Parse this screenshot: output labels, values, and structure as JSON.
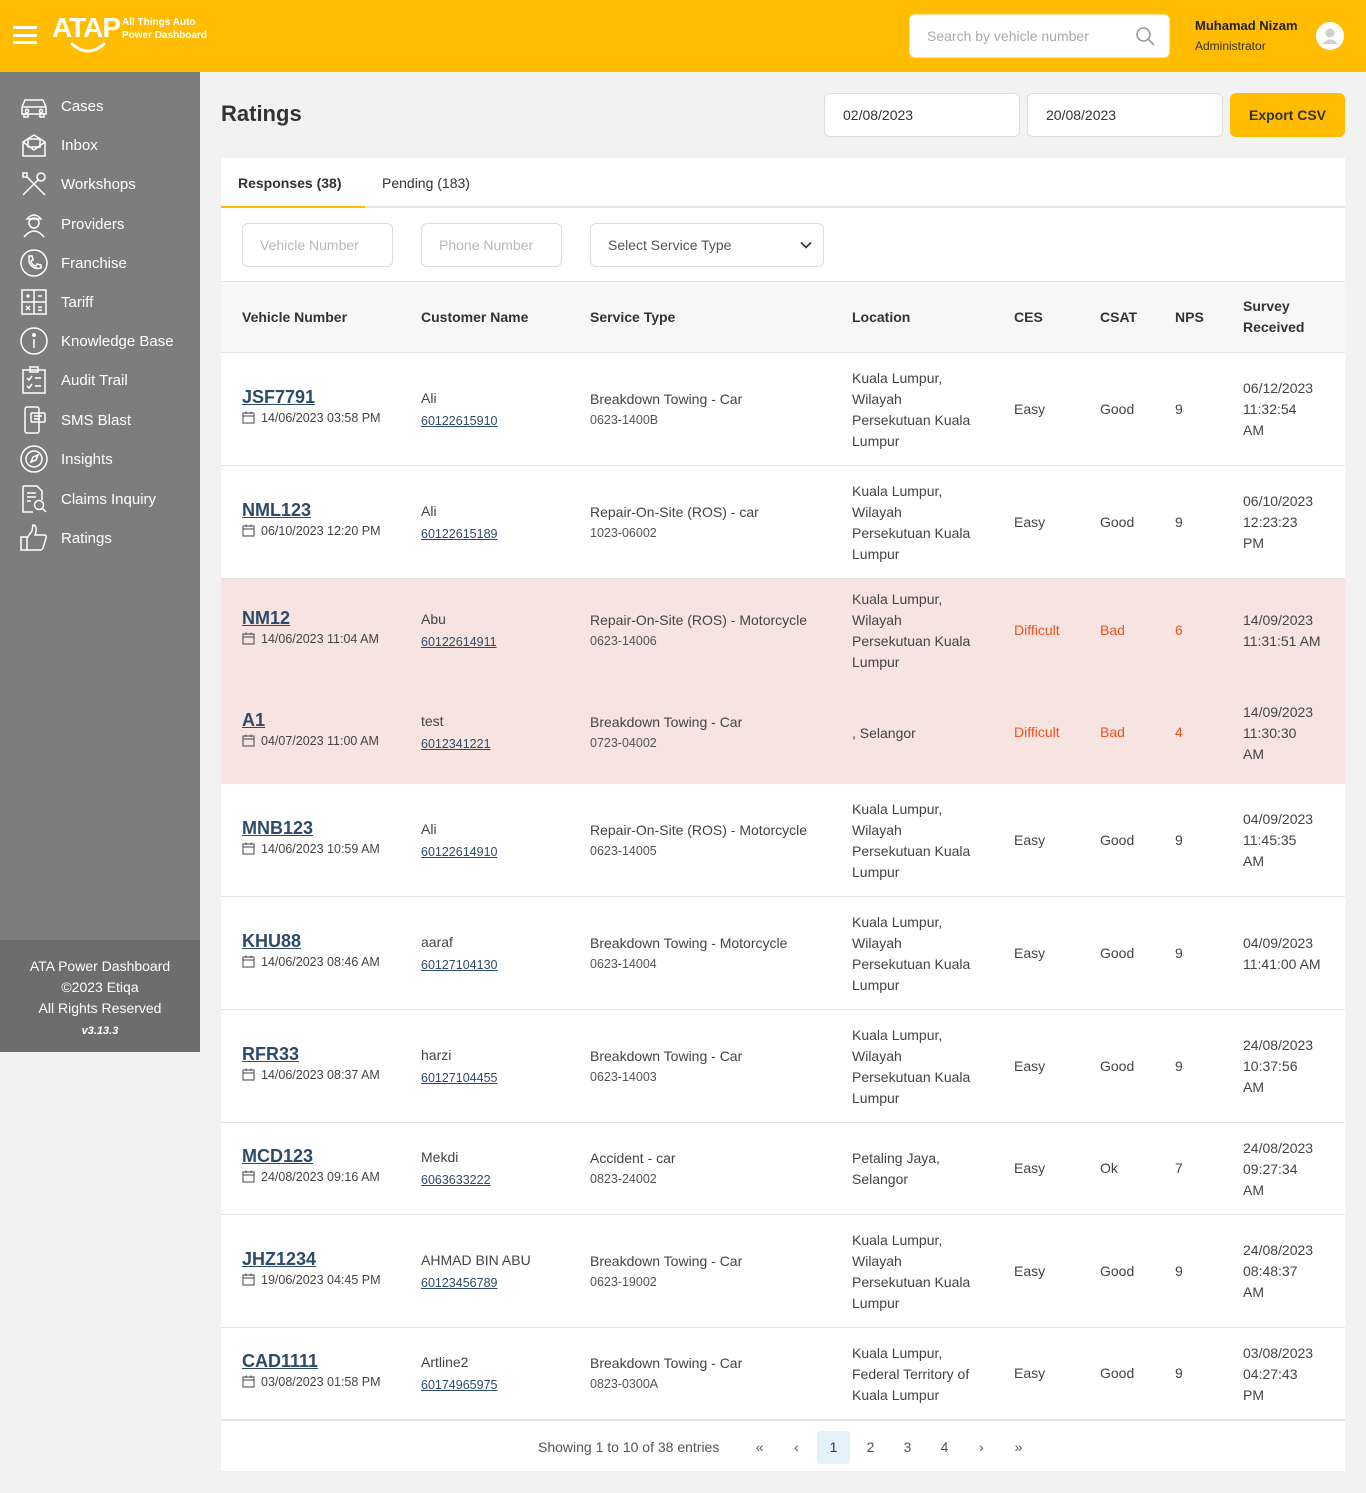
{
  "brand": {
    "logo_text": "ATAP",
    "tagline_1": "All Things Auto",
    "tagline_2": "Power Dashboard"
  },
  "search": {
    "placeholder": "Search by vehicle number"
  },
  "user": {
    "name": "Muhamad Nizam",
    "role": "Administrator"
  },
  "sidebar": {
    "items": [
      {
        "label": "Cases",
        "icon": "car-icon"
      },
      {
        "label": "Inbox",
        "icon": "inbox-icon"
      },
      {
        "label": "Workshops",
        "icon": "tools-icon"
      },
      {
        "label": "Providers",
        "icon": "mechanic-icon"
      },
      {
        "label": "Franchise",
        "icon": "phone-icon"
      },
      {
        "label": "Tariff",
        "icon": "calculator-icon"
      },
      {
        "label": "Knowledge Base",
        "icon": "info-icon"
      },
      {
        "label": "Audit Trail",
        "icon": "checklist-icon"
      },
      {
        "label": "SMS Blast",
        "icon": "sms-icon"
      },
      {
        "label": "Insights",
        "icon": "insights-icon"
      },
      {
        "label": "Claims Inquiry",
        "icon": "document-search-icon"
      },
      {
        "label": "Ratings",
        "icon": "thumbs-up-icon"
      }
    ],
    "footer": {
      "line1": "ATA Power Dashboard",
      "line2": "©2023 Etiqa",
      "line3": "All Rights Reserved",
      "version": "v3.13.3"
    }
  },
  "page": {
    "title": "Ratings",
    "date_from": "02/08/2023",
    "date_to": "20/08/2023",
    "export_label": "Export CSV"
  },
  "tabs": [
    {
      "label": "Responses (38)"
    },
    {
      "label": "Pending (183)"
    }
  ],
  "filters": {
    "vehicle_placeholder": "Vehicle Number",
    "phone_placeholder": "Phone Number",
    "service_type": "Select Service Type"
  },
  "table": {
    "headers": {
      "vehicle": "Vehicle Number",
      "customer": "Customer Name",
      "service": "Service Type",
      "location": "Location",
      "ces": "CES",
      "csat": "CSAT",
      "nps": "NPS",
      "survey_1": "Survey",
      "survey_2": "Received"
    },
    "rows": [
      {
        "vehicle": "JSF7791",
        "date": "14/06/2023 03:58 PM",
        "customer": "Ali",
        "phone": "60122615910",
        "service": "Breakdown Towing - Car",
        "code": "0623-1400B",
        "loc": [
          "Kuala Lumpur,",
          "Wilayah",
          "Persekutuan Kuala",
          "Lumpur"
        ],
        "ces": "Easy",
        "csat": "Good",
        "nps": "9",
        "survey": [
          "06/12/2023",
          "11:32:54",
          "AM"
        ]
      },
      {
        "vehicle": "NML123",
        "date": "06/10/2023 12:20 PM",
        "customer": "Ali",
        "phone": "60122615189",
        "service": "Repair-On-Site (ROS) - car",
        "code": "1023-06002",
        "loc": [
          "Kuala Lumpur,",
          "Wilayah",
          "Persekutuan Kuala",
          "Lumpur"
        ],
        "ces": "Easy",
        "csat": "Good",
        "nps": "9",
        "survey": [
          "06/10/2023",
          "12:23:23",
          "PM"
        ]
      },
      {
        "vehicle": "NM12",
        "date": "14/06/2023 11:04 AM",
        "customer": "Abu",
        "phone": "60122614911",
        "service": "Repair-On-Site (ROS) - Motorcycle",
        "code": "0623-14006",
        "loc": [
          "Kuala Lumpur,",
          "Wilayah",
          "Persekutuan Kuala",
          "Lumpur"
        ],
        "ces": "Difficult",
        "csat": "Bad",
        "nps": "6",
        "survey": [
          "14/09/2023",
          "11:31:51 AM"
        ]
      },
      {
        "vehicle": "A1",
        "date": "04/07/2023 11:00 AM",
        "customer": "test",
        "phone": "6012341221",
        "service": "Breakdown Towing - Car",
        "code": "0723-04002",
        "loc": [
          ", Selangor"
        ],
        "ces": "Difficult",
        "csat": "Bad",
        "nps": "4",
        "survey": [
          "14/09/2023",
          "11:30:30",
          "AM"
        ]
      },
      {
        "vehicle": "MNB123",
        "date": "14/06/2023 10:59 AM",
        "customer": "Ali",
        "phone": "60122614910",
        "service": "Repair-On-Site (ROS) - Motorcycle",
        "code": "0623-14005",
        "loc": [
          "Kuala Lumpur,",
          "Wilayah",
          "Persekutuan Kuala",
          "Lumpur"
        ],
        "ces": "Easy",
        "csat": "Good",
        "nps": "9",
        "survey": [
          "04/09/2023",
          "11:45:35",
          "AM"
        ]
      },
      {
        "vehicle": "KHU88",
        "date": "14/06/2023 08:46 AM",
        "customer": "aaraf",
        "phone": "60127104130",
        "service": "Breakdown Towing - Motorcycle",
        "code": "0623-14004",
        "loc": [
          "Kuala Lumpur,",
          "Wilayah",
          "Persekutuan Kuala",
          "Lumpur"
        ],
        "ces": "Easy",
        "csat": "Good",
        "nps": "9",
        "survey": [
          "04/09/2023",
          "11:41:00 AM"
        ]
      },
      {
        "vehicle": "RFR33",
        "date": "14/06/2023 08:37 AM",
        "customer": "harzi",
        "phone": "60127104455",
        "service": "Breakdown Towing - Car",
        "code": "0623-14003",
        "loc": [
          "Kuala Lumpur,",
          "Wilayah",
          "Persekutuan Kuala",
          "Lumpur"
        ],
        "ces": "Easy",
        "csat": "Good",
        "nps": "9",
        "survey": [
          "24/08/2023",
          "10:37:56",
          "AM"
        ]
      },
      {
        "vehicle": "MCD123",
        "date": "24/08/2023 09:16 AM",
        "customer": "Mekdi",
        "phone": "6063633222",
        "service": "Accident - car",
        "code": "0823-24002",
        "loc": [
          "Petaling Jaya,",
          "Selangor"
        ],
        "ces": "Easy",
        "csat": "Ok",
        "nps": "7",
        "survey": [
          "24/08/2023",
          "09:27:34",
          "AM"
        ]
      },
      {
        "vehicle": "JHZ1234",
        "date": "19/06/2023 04:45 PM",
        "customer": "AHMAD BIN ABU",
        "phone": "60123456789",
        "service": "Breakdown Towing - Car",
        "code": "0623-19002",
        "loc": [
          "Kuala Lumpur,",
          "Wilayah",
          "Persekutuan Kuala",
          "Lumpur"
        ],
        "ces": "Easy",
        "csat": "Good",
        "nps": "9",
        "survey": [
          "24/08/2023",
          "08:48:37",
          "AM"
        ]
      },
      {
        "vehicle": "CAD1111",
        "date": "03/08/2023 01:58 PM",
        "customer": "Artline2",
        "phone": "60174965975",
        "service": "Breakdown Towing - Car",
        "code": "0823-0300A",
        "loc": [
          "Kuala Lumpur,",
          "Federal Territory of",
          "Kuala Lumpur"
        ],
        "ces": "Easy",
        "csat": "Good",
        "nps": "9",
        "survey": [
          "03/08/2023",
          "04:27:43",
          "PM"
        ]
      }
    ]
  },
  "pagination": {
    "info": "Showing 1 to 10 of 38 entries",
    "first": "«",
    "prev": "‹",
    "pages": [
      "1",
      "2",
      "3",
      "4"
    ],
    "next": "›",
    "last": "»",
    "current": "1"
  },
  "colors": {
    "accent": "#ffbc00",
    "sidebar": "#7d7d7d",
    "bad_row": "#f7e3df",
    "bad_text": "#f4511e",
    "link": "#2d4a6b"
  }
}
